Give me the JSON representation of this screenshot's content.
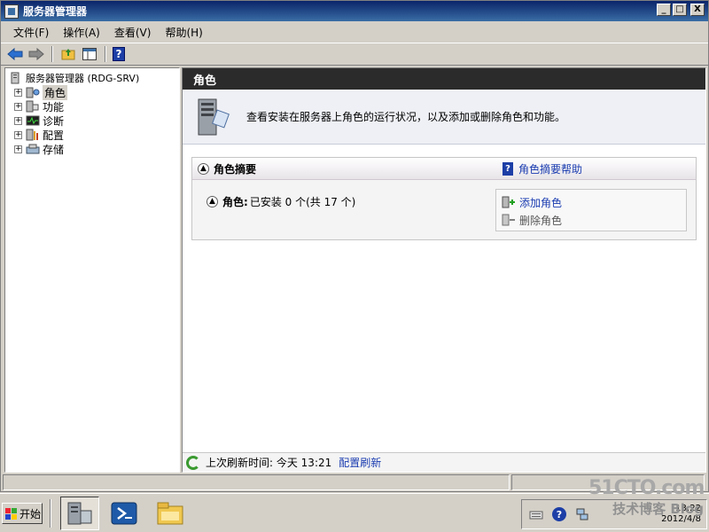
{
  "window": {
    "title": "服务器管理器",
    "controls": {
      "minimize": "_",
      "maximize": "□",
      "close": "X"
    }
  },
  "menubar": {
    "items": [
      {
        "label": "文件(F)"
      },
      {
        "label": "操作(A)"
      },
      {
        "label": "查看(V)"
      },
      {
        "label": "帮助(H)"
      }
    ]
  },
  "toolbar": {
    "icons": [
      "back-arrow-icon",
      "forward-arrow-icon",
      "up-folder-icon",
      "show-hide-tree-icon",
      "help-icon"
    ],
    "help_glyph": "?"
  },
  "tree": {
    "root": "服务器管理器 (RDG-SRV)",
    "items": [
      {
        "label": "角色",
        "expander": "+",
        "icon": "roles-icon",
        "selected": true
      },
      {
        "label": "功能",
        "expander": "+",
        "icon": "features-icon"
      },
      {
        "label": "诊断",
        "expander": "+",
        "icon": "diagnostics-icon"
      },
      {
        "label": "配置",
        "expander": "+",
        "icon": "configuration-icon"
      },
      {
        "label": "存储",
        "expander": "+",
        "icon": "storage-icon"
      }
    ]
  },
  "content": {
    "header": "角色",
    "intro": "查看安装在服务器上角色的运行状况，以及添加或删除角色和功能。",
    "summary": {
      "title": "角色摘要",
      "help_link": "角色摘要帮助",
      "roles_label": "角色:",
      "roles_status": "已安装 0 个(共 17 个)",
      "actions": [
        {
          "label": "添加角色",
          "enabled": true
        },
        {
          "label": "删除角色",
          "enabled": false
        }
      ]
    },
    "footer": {
      "last_refresh_label": "上次刷新时间: 今天 13:21",
      "configure_refresh": "配置刷新"
    }
  },
  "taskbar": {
    "start_label": "开始",
    "apps": [
      "server-manager-icon",
      "powershell-icon",
      "explorer-icon"
    ],
    "clock_time": "13:22",
    "clock_date": "2012/4/8"
  },
  "watermark": {
    "site": "51CTO.com",
    "tagline": "技术博客",
    "blog": "Blog"
  },
  "colors": {
    "title_bar": "#0a246a",
    "content_header": "#2b2b2b",
    "link": "#1a3cb0"
  }
}
